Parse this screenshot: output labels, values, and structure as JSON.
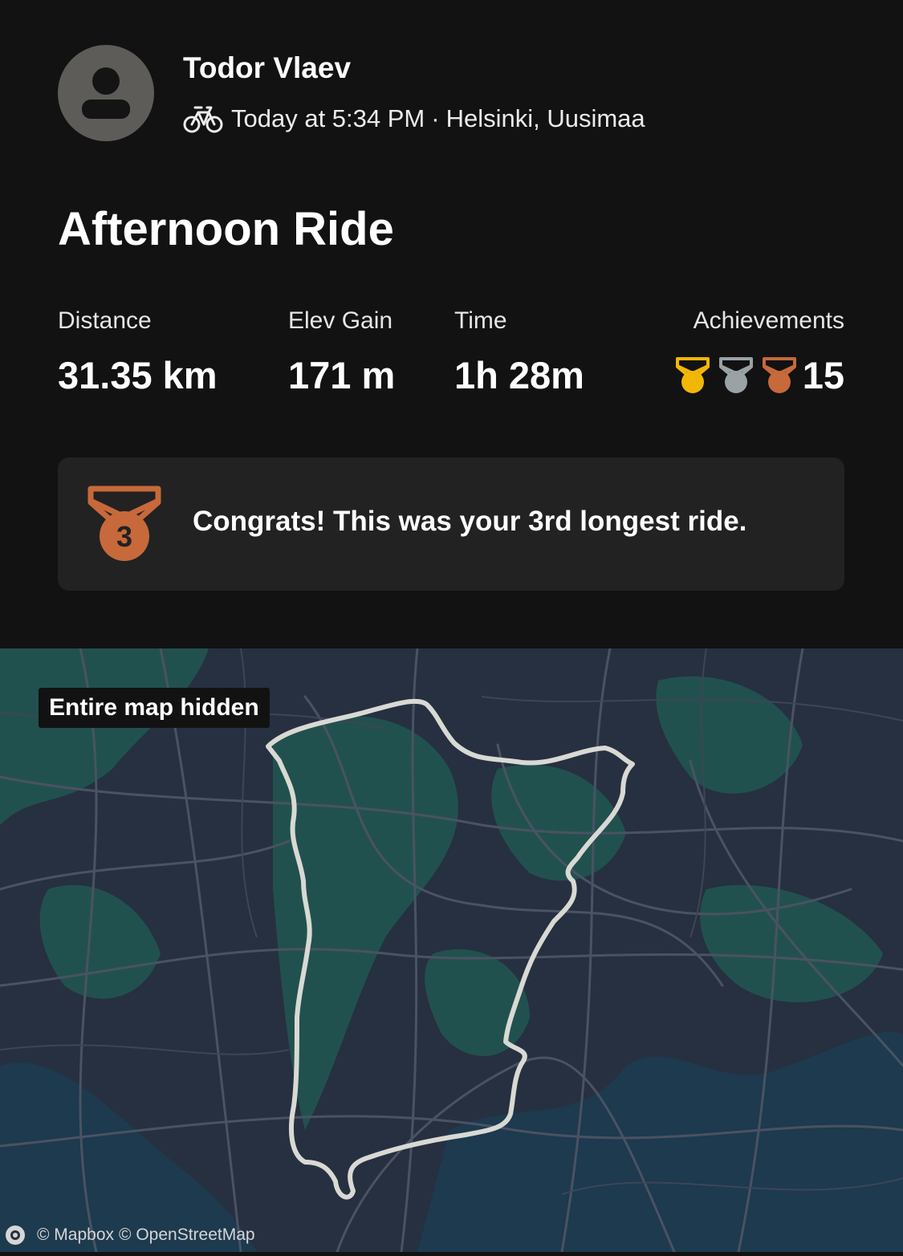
{
  "athlete": {
    "name": "Todor Vlaev",
    "activity_icon": "bike-icon",
    "date_time": "Today at 5:34 PM",
    "separator": "·",
    "location": "Helsinki, Uusimaa"
  },
  "activity": {
    "title": "Afternoon Ride"
  },
  "stats": {
    "distance": {
      "label": "Distance",
      "value": "31.35 km"
    },
    "elev_gain": {
      "label": "Elev Gain",
      "value": "171 m"
    },
    "time": {
      "label": "Time",
      "value": "1h 28m"
    },
    "achievements": {
      "label": "Achievements",
      "medals": [
        "gold-medal-icon",
        "silver-medal-icon",
        "bronze-medal-icon"
      ],
      "count": "15"
    }
  },
  "congrats": {
    "medal_icon": "bronze-medal-icon",
    "medal_rank": "3",
    "text": "Congrats! This was your 3rd longest ride."
  },
  "map": {
    "hidden_label": "Entire map hidden",
    "attribution": {
      "mapbox": "© Mapbox",
      "osm": "© OpenStreetMap"
    }
  },
  "colors": {
    "background": "#121212",
    "card": "#222222",
    "gold": "#f2b705",
    "silver": "#9aa2a6",
    "bronze": "#c7693a",
    "route": "#d9d9d4",
    "map_land": "#263040",
    "map_green": "#21514e",
    "map_water": "#1d3a4e"
  }
}
